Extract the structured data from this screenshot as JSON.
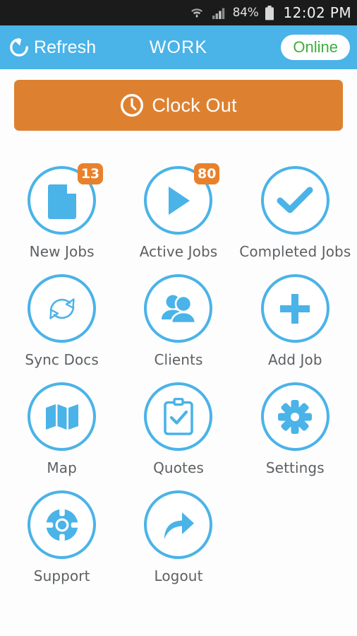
{
  "status_bar": {
    "wifi_icon": "wifi-transfer-icon",
    "signal_icon": "cellular-signal-icon",
    "battery_percent": "84%",
    "battery_icon": "battery-icon",
    "time": "12:02 PM"
  },
  "header": {
    "refresh_icon": "refresh-icon",
    "refresh_label": "Refresh",
    "title": "WORK",
    "status_label": "Online",
    "background_color": "#4ab3e8",
    "status_text_color": "#3fae3f"
  },
  "clock_button": {
    "icon": "clock-icon",
    "label": "Clock Out",
    "background_color": "#dd8130"
  },
  "grid": {
    "accent_color": "#4ab3e8",
    "badge_color": "#e9812c",
    "tiles": [
      {
        "label": "New Jobs",
        "icon": "document-icon",
        "badge": "13"
      },
      {
        "label": "Active Jobs",
        "icon": "play-icon",
        "badge": "80"
      },
      {
        "label": "Completed Jobs",
        "icon": "check-icon",
        "badge": ""
      },
      {
        "label": "Sync Docs",
        "icon": "sync-icon",
        "badge": ""
      },
      {
        "label": "Clients",
        "icon": "people-icon",
        "badge": ""
      },
      {
        "label": "Add Job",
        "icon": "plus-icon",
        "badge": ""
      },
      {
        "label": "Map",
        "icon": "map-icon",
        "badge": ""
      },
      {
        "label": "Quotes",
        "icon": "clipboard-check-icon",
        "badge": ""
      },
      {
        "label": "Settings",
        "icon": "gear-icon",
        "badge": ""
      },
      {
        "label": "Support",
        "icon": "life-ring-icon",
        "badge": ""
      },
      {
        "label": "Logout",
        "icon": "share-arrow-icon",
        "badge": ""
      }
    ]
  }
}
